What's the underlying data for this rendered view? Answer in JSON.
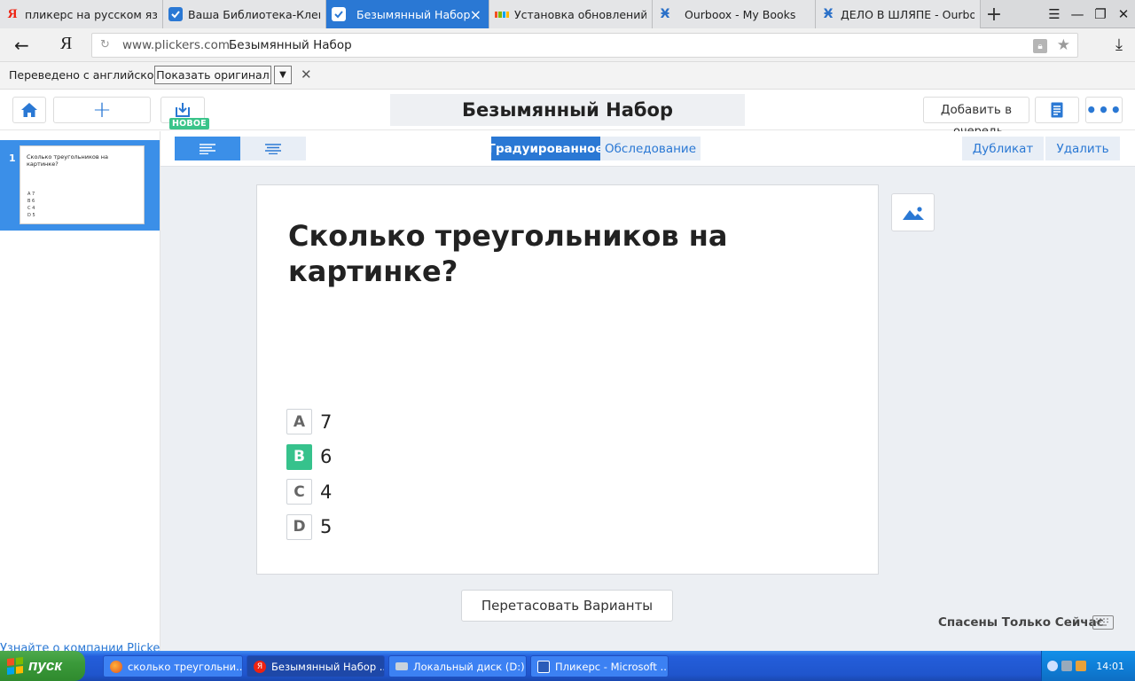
{
  "browser": {
    "tabs": [
      {
        "title": "пликерс на русском язык",
        "icon": "yandex-icon",
        "active": false
      },
      {
        "title": "Ваша Библиотека-Клещ",
        "icon": "check-icon",
        "active": false
      },
      {
        "title": "Безымянный Набор",
        "icon": "check-icon",
        "active": true
      },
      {
        "title": "Установка обновлений О",
        "icon": "windows-icon",
        "active": false
      },
      {
        "title": "Ourboox - My Books",
        "icon": "ourboox-icon",
        "active": false
      },
      {
        "title": "ДЕЛО В ШЛЯПЕ - Ourboo",
        "icon": "ourboox-icon",
        "active": false
      }
    ],
    "new_tab_label": "+",
    "address": {
      "domain": "www.plickers.com",
      "page_title": "Безымянный Набор"
    },
    "yandex_label": "Я"
  },
  "translate_bar": {
    "label": "Переведено с английского",
    "show_original": "Показать оригинал"
  },
  "toolbar": {
    "set_title": "Безымянный Набор",
    "new_badge": "НОВОЕ",
    "add_to_queue": "Добавить в",
    "add_to_queue_overflow": "очередь"
  },
  "sidebar": {
    "slides": [
      {
        "number": "1",
        "question": "Сколько треугольников на картинке?",
        "answers": [
          "A  7",
          "B  6",
          "C  4",
          "D  5"
        ]
      }
    ],
    "about_link": "Узнайте о компании Plickers"
  },
  "subbar": {
    "graded": "Градуированное",
    "survey": "Обследование",
    "duplicate": "Дубликат",
    "delete": "Удалить"
  },
  "question": {
    "text": "Сколько треугольников на картинке?",
    "answers": [
      {
        "letter": "A",
        "text": "7",
        "correct": false
      },
      {
        "letter": "B",
        "text": "6",
        "correct": true
      },
      {
        "letter": "C",
        "text": "4",
        "correct": false
      },
      {
        "letter": "D",
        "text": "5",
        "correct": false
      }
    ]
  },
  "footer": {
    "shuffle": "Перетасовать Варианты",
    "saved_status": "Спасены Только Сейчас"
  },
  "taskbar": {
    "start": "пуск",
    "tasks": [
      {
        "title": "сколько треугольни...",
        "active": false
      },
      {
        "title": "Безымянный Набор ...",
        "active": true
      },
      {
        "title": "Локальный диск (D:)",
        "active": false
      },
      {
        "title": "Пликерс - Microsoft ...",
        "active": false
      }
    ],
    "clock": "14:01"
  },
  "colors": {
    "accent": "#2a78d4",
    "correct": "#36c28c",
    "xp_taskbar": "#245edb",
    "xp_start": "#3b9a3a"
  }
}
